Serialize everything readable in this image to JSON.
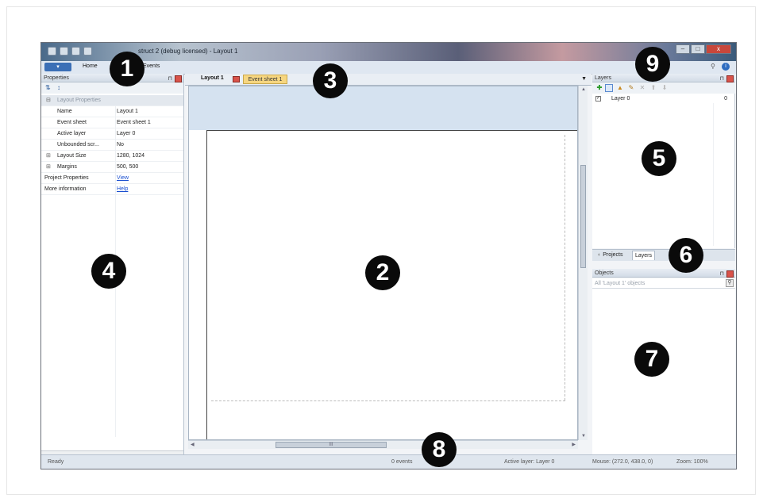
{
  "window": {
    "title": "Construct 2 (debug licensed) - Layout 1",
    "title_visible": "struct 2 (debug licensed) - Layout 1"
  },
  "ribbon": {
    "file_label": "",
    "tabs": [
      "Home",
      "Events"
    ]
  },
  "properties": {
    "header": "Properties",
    "category": "Layout Properties",
    "rows": [
      {
        "key": "Name",
        "value": "Layout 1"
      },
      {
        "key": "Event sheet",
        "value": "Event sheet 1"
      },
      {
        "key": "Active layer",
        "value": "Layer 0"
      },
      {
        "key": "Unbounded scr...",
        "value": "No"
      },
      {
        "key": "Layout Size",
        "value": "1280, 1024"
      },
      {
        "key": "Margins",
        "value": "500, 500"
      },
      {
        "key": "Project Properties",
        "value": "View"
      },
      {
        "key": "More information",
        "value": "Help"
      }
    ]
  },
  "editor": {
    "tabs": [
      "Layout 1",
      "Event sheet 1"
    ],
    "scroll_grip": "III"
  },
  "layers": {
    "header": "Layers",
    "rows": [
      {
        "name": "Layer 0",
        "index": "0"
      }
    ]
  },
  "bottom_tabs": [
    "Projects",
    "Layers"
  ],
  "objects": {
    "header": "Objects",
    "filter": "All 'Layout 1' objects"
  },
  "status": {
    "ready": "Ready",
    "events": "0 events",
    "active_layer": "Active layer: Layer 0",
    "mouse": "Mouse: (272.0, 438.0, 0)",
    "zoom": "Zoom: 100%"
  },
  "callouts": [
    "1",
    "2",
    "3",
    "4",
    "5",
    "6",
    "7",
    "8",
    "9"
  ]
}
